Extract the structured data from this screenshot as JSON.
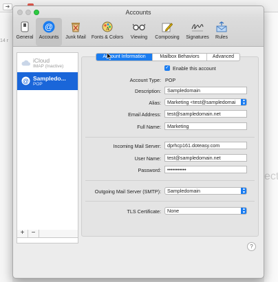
{
  "window": {
    "title": "Accounts"
  },
  "background": {
    "left_text": "14 r",
    "right_text": "ect"
  },
  "toolbar": {
    "items": [
      {
        "label": "General",
        "icon": "general-switch-icon"
      },
      {
        "label": "Accounts",
        "icon": "at-sign-icon",
        "selected": true
      },
      {
        "label": "Junk Mail",
        "icon": "trash-icon"
      },
      {
        "label": "Fonts & Colors",
        "icon": "palette-icon"
      },
      {
        "label": "Viewing",
        "icon": "glasses-icon"
      },
      {
        "label": "Composing",
        "icon": "pencil-icon"
      },
      {
        "label": "Signatures",
        "icon": "signature-icon"
      },
      {
        "label": "Rules",
        "icon": "rules-envelope-icon"
      }
    ]
  },
  "accounts": [
    {
      "name": "iCloud",
      "sub": "IMAP (Inactive)",
      "icon": "cloud-icon",
      "selected": false
    },
    {
      "name": "Sampledo...",
      "sub": "POP",
      "icon": "at-sign-icon",
      "selected": true
    }
  ],
  "list_buttons": {
    "add": "+",
    "remove": "−"
  },
  "tabs": [
    {
      "label": "Account Information",
      "active": true
    },
    {
      "label": "Mailbox Behaviors",
      "active": false
    },
    {
      "label": "Advanced",
      "active": false
    }
  ],
  "form": {
    "enable_label": "Enable this account",
    "enable_checked": true,
    "account_type_label": "Account Type:",
    "account_type_value": "POP",
    "description_label": "Description:",
    "description_value": "Sampledomain",
    "alias_label": "Alias:",
    "alias_value": "Marketing <test@sampledomai",
    "email_label": "Email Address:",
    "email_value": "test@sampledomain.net",
    "fullname_label": "Full Name:",
    "fullname_value": "Marketing",
    "incoming_label": "Incoming Mail Server:",
    "incoming_value": "dprhcp161.doteasy.com",
    "username_label": "User Name:",
    "username_value": "test@sampledomain.net",
    "password_label": "Password:",
    "password_value": "•••••••••••",
    "smtp_label": "Outgoing Mail Server (SMTP):",
    "smtp_value": "Sampledomain",
    "tls_label": "TLS Certificate:",
    "tls_value": "None"
  },
  "help": {
    "label": "?"
  },
  "colors": {
    "accent": "#1a7cf0",
    "selection": "#1a66d9",
    "zoom_green": "#2ecb42"
  }
}
